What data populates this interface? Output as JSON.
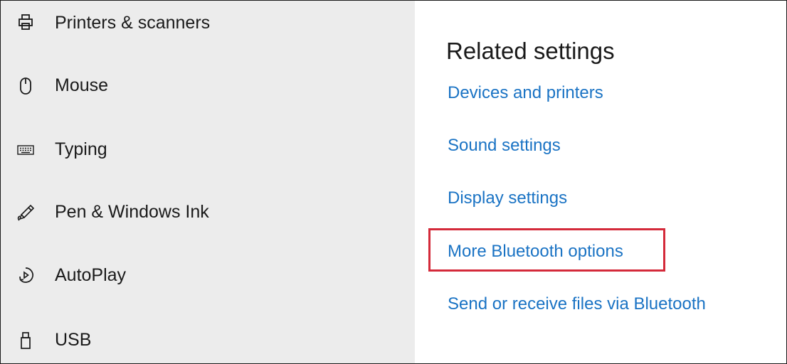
{
  "sidebar": {
    "items": [
      {
        "label": "Printers & scanners",
        "icon": "printer-icon"
      },
      {
        "label": "Mouse",
        "icon": "mouse-icon"
      },
      {
        "label": "Typing",
        "icon": "keyboard-icon"
      },
      {
        "label": "Pen & Windows Ink",
        "icon": "pen-icon"
      },
      {
        "label": "AutoPlay",
        "icon": "autoplay-icon"
      },
      {
        "label": "USB",
        "icon": "usb-icon"
      }
    ]
  },
  "main": {
    "section_title": "Related settings",
    "links": [
      {
        "label": "Devices and printers"
      },
      {
        "label": "Sound settings"
      },
      {
        "label": "Display settings"
      },
      {
        "label": "More Bluetooth options",
        "highlighted": true
      },
      {
        "label": "Send or receive files via Bluetooth"
      }
    ]
  },
  "colors": {
    "sidebar_bg": "#ececec",
    "link": "#1a73c4",
    "highlight": "#d42a3a",
    "text": "#1a1a1a"
  }
}
